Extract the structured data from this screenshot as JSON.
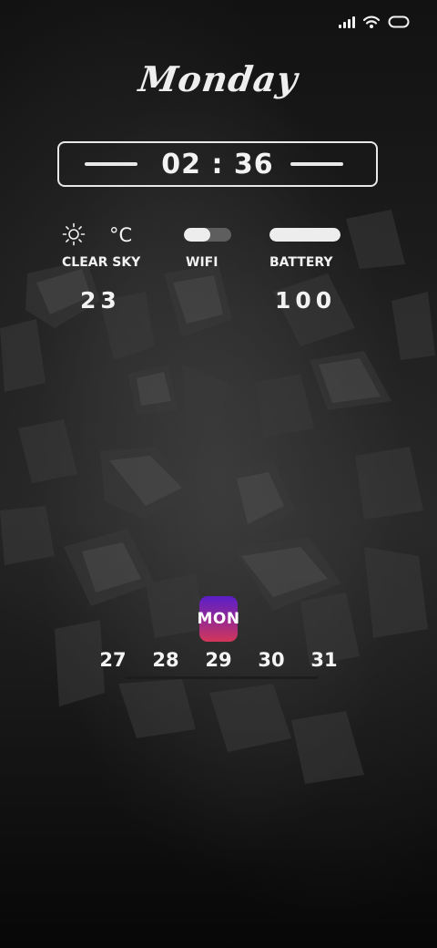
{
  "status_bar": {
    "signal_icon": "cellular-signal-icon",
    "wifi_icon": "wifi-icon",
    "battery_icon": "battery-outline-icon"
  },
  "day_title": "Monday",
  "clock": {
    "time": "02 : 36"
  },
  "weather": {
    "icon": "sun-icon",
    "unit": "°C",
    "condition": "CLEAR SKY",
    "temperature": "23"
  },
  "wifi": {
    "label": "WIFI",
    "toggle_level": 0.55
  },
  "battery": {
    "label": "BATTERY",
    "value": "100",
    "level": 1.0
  },
  "calendar": {
    "day_abbr": "MON",
    "dates": [
      "27",
      "28",
      "29",
      "30",
      "31"
    ],
    "accent_gradient": [
      "#5a1ec8",
      "#d4365a"
    ]
  },
  "colors": {
    "text": "#f2f2f2",
    "background": "#1a1a1a"
  }
}
